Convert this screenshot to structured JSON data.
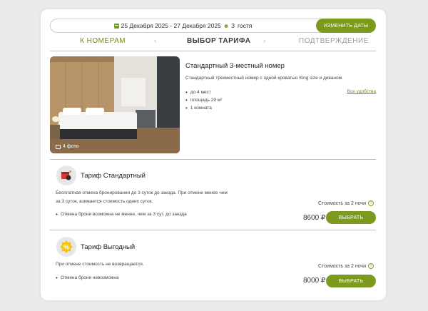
{
  "booking": {
    "dates": "25 Декабря 2025 - 27 Декабря 2025",
    "guests": "3",
    "guests_label": "гостя",
    "change_dates_label": "ИЗМЕНИТЬ ДАТЫ"
  },
  "steps": {
    "rooms": "К НОМЕРАМ",
    "tariff": "ВЫБОР ТАРИФА",
    "confirm": "ПОДТВЕРЖДЕНИЕ"
  },
  "room": {
    "title": "Стандартный 3-местный номер",
    "description": "Стандартный трехместный номер с одной кроватью King size и диваном.",
    "all_amenities": "Все удобства",
    "photo_count": "4 фото",
    "features": [
      "до 4 мест",
      "площадь 29 м²",
      "1 комната"
    ]
  },
  "tariffs": [
    {
      "title": "Тариф Стандартный",
      "description_lines": [
        "Бесплатная отмена бронирования до 3 суток до заезда. При отмене менее чем",
        "за 3 суток, взимается стоимость одних суток."
      ],
      "bullet": "Отмена брони возможна не менее, чем за 3 сут. до заезда",
      "cost_label": "Стоимость за 2 ночи",
      "price": "8600 ₽",
      "select_label": "ВЫБРАТЬ",
      "icon": "cancellation-calendar-icon"
    },
    {
      "title": "Тариф Выгодный",
      "description_lines": [
        "При отмене стоимость не возвращается."
      ],
      "bullet": "Отмена брони невозможна",
      "cost_label": "Стоимость за 2 ночи",
      "price": "8000 ₽",
      "select_label": "ВЫБРАТЬ",
      "icon": "percent-badge-icon"
    }
  ],
  "colors": {
    "accent": "#7c9a1e",
    "accent_text": "#6e8c1a",
    "background": "#ebebeb",
    "card": "#ffffff"
  }
}
